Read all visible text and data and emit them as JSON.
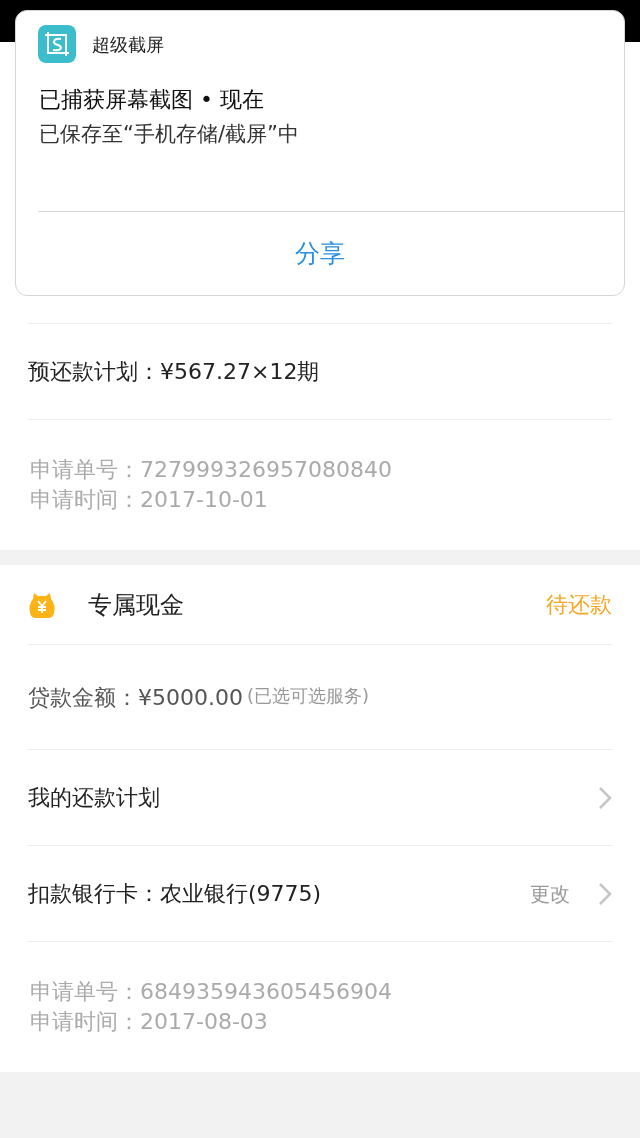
{
  "notification": {
    "app_name": "超级截屏",
    "title": "已捕获屏幕截图 • 现在",
    "body": "已保存至“手机存储/截屏”中",
    "action": "分享"
  },
  "sections": [
    {
      "rows": [
        {
          "kind": "text",
          "label": "预还款计划：¥567.27×12期"
        },
        {
          "kind": "info",
          "lines": [
            "申请单号：727999326957080840",
            "申请时间：2017-10-01"
          ]
        }
      ]
    },
    {
      "header": {
        "title": "专属现金",
        "status": "待还款"
      },
      "rows": [
        {
          "kind": "amount",
          "label": "贷款金额：¥5000.00",
          "note": "(已选可选服务)"
        },
        {
          "kind": "link",
          "label": "我的还款计划"
        },
        {
          "kind": "link",
          "label": "扣款银行卡：农业银行(9775)",
          "action": "更改"
        },
        {
          "kind": "info",
          "lines": [
            "申请单号：684935943605456904",
            "申请时间：2017-08-03"
          ]
        }
      ]
    }
  ]
}
